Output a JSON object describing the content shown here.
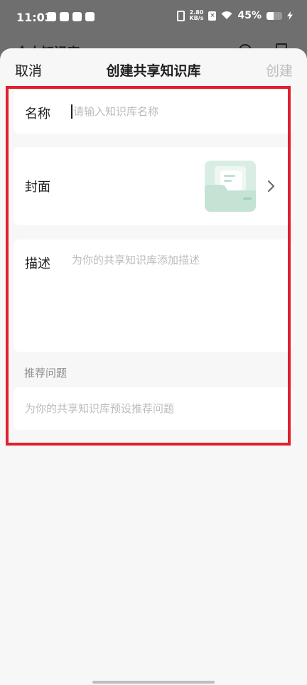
{
  "status_bar": {
    "time": "11:03",
    "net_speed_value": "2.80",
    "net_speed_unit": "KB/s",
    "battery_percent": "45%",
    "battery_level": 0.45
  },
  "background_app": {
    "title": "个人知识库"
  },
  "sheet": {
    "cancel_label": "取消",
    "title": "创建共享知识库",
    "create_label": "创建"
  },
  "form": {
    "name_label": "名称",
    "name_placeholder": "请输入知识库名称",
    "cover_label": "封面",
    "description_label": "描述",
    "description_placeholder": "为你的共享知识库添加描述",
    "recommend_title": "推荐问题",
    "recommend_placeholder": "为你的共享知识库预设推荐问题"
  },
  "colors": {
    "highlight": "#e0202c",
    "sheet_background": "#f7f7f7",
    "cover_thumbnail": "#d9ede4",
    "disabled_text": "#bdbdbd"
  }
}
